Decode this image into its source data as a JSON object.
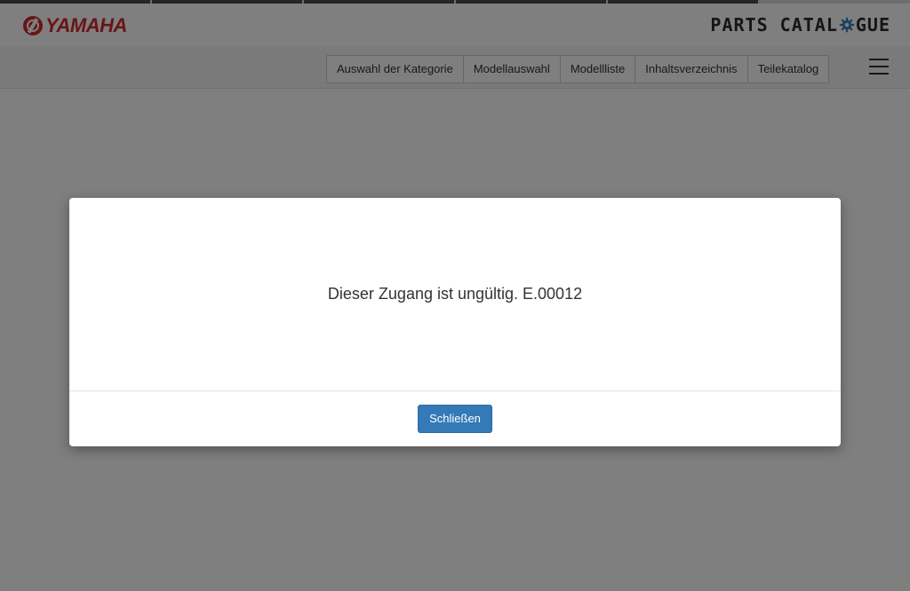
{
  "header": {
    "brand_name": "YAMAHA",
    "catalogue_prefix": "PARTS CATAL",
    "catalogue_suffix": "GUE"
  },
  "nav": {
    "tabs": [
      {
        "label": "Auswahl der Kategorie"
      },
      {
        "label": "Modellauswahl"
      },
      {
        "label": "Modellliste"
      },
      {
        "label": "Inhaltsverzeichnis"
      },
      {
        "label": "Teilekatalog"
      }
    ]
  },
  "modal": {
    "message": "Dieser Zugang ist ungültig. E.00012",
    "close_label": "Schließen"
  },
  "colors": {
    "brand_red": "#d12a2f",
    "primary_button": "#337ab7",
    "gear_blue": "#3a7fc0"
  },
  "icons": {
    "brand": "yamaha-tuning-fork-emblem",
    "logo_gear": "gear-icon",
    "menu": "hamburger-menu-icon"
  }
}
